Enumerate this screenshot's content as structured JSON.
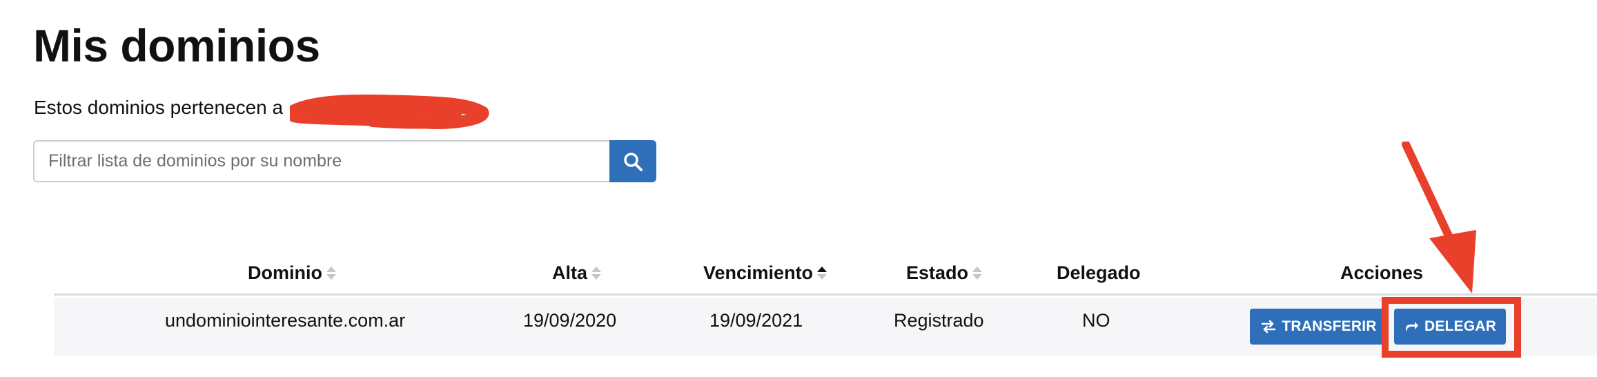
{
  "page": {
    "title": "Mis dominios",
    "owner_text": "Estos dominios pertenecen a"
  },
  "search": {
    "placeholder": "Filtrar lista de dominios por su nombre",
    "value": "",
    "icon": "search-icon"
  },
  "table": {
    "columns": [
      {
        "label": "Dominio",
        "sortable": true,
        "sort_active": false
      },
      {
        "label": "Alta",
        "sortable": true,
        "sort_active": false
      },
      {
        "label": "Vencimiento",
        "sortable": true,
        "sort_active": true,
        "sort_direction": "asc"
      },
      {
        "label": "Estado",
        "sortable": true,
        "sort_active": false
      },
      {
        "label": "Delegado",
        "sortable": false
      },
      {
        "label": "Acciones",
        "sortable": false
      }
    ],
    "rows": [
      {
        "dominio": "undominiointeresante.com.ar",
        "alta": "19/09/2020",
        "vencimiento": "19/09/2021",
        "estado": "Registrado",
        "delegado": "NO",
        "actions": {
          "transfer_label": "TRANSFERIR",
          "transfer_icon": "transfer-arrows-icon",
          "delegate_label": "DELEGAR",
          "delegate_icon": "share-arrow-icon"
        }
      }
    ]
  },
  "colors": {
    "primary": "#2f6fba",
    "annotation": "#e8402a",
    "row_bg": "#f6f6f8",
    "header_border": "#d8dade"
  }
}
